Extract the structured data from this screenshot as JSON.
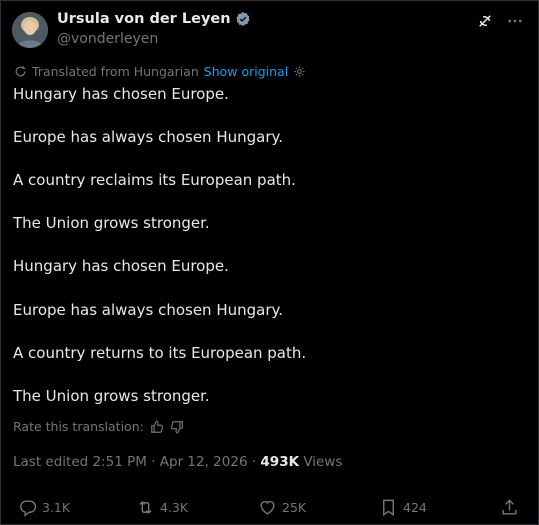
{
  "author": {
    "name": "Ursula von der Leyen",
    "handle": "@vonderleyen"
  },
  "icons": {
    "verified": "verified-badge-icon",
    "grok": "grok-icon",
    "more": "more-icon"
  },
  "translation": {
    "note": "Translated from Hungarian",
    "show_original": "Show original"
  },
  "tweet": {
    "lines": [
      "Hungary has chosen Europe.",
      "Europe has always chosen Hungary.",
      "A country reclaims its European path.",
      "The Union grows stronger.",
      "Hungary has chosen Europe.",
      "Europe has always chosen Hungary.",
      "A country returns to its European path.",
      "The Union grows stronger."
    ]
  },
  "rate": {
    "label": "Rate this translation:"
  },
  "meta": {
    "edited": "Last edited 2:51 PM · Apr 12, 2026 · ",
    "views_count": "493K",
    "views_label": " Views"
  },
  "actions": {
    "replies": "3.1K",
    "reposts": "4.3K",
    "likes": "25K",
    "bookmarks": "424"
  },
  "colors": {
    "background": "#000000",
    "text": "#e7e9ea",
    "muted": "#71767b",
    "link": "#1d9bf0",
    "border": "#2f3336"
  }
}
